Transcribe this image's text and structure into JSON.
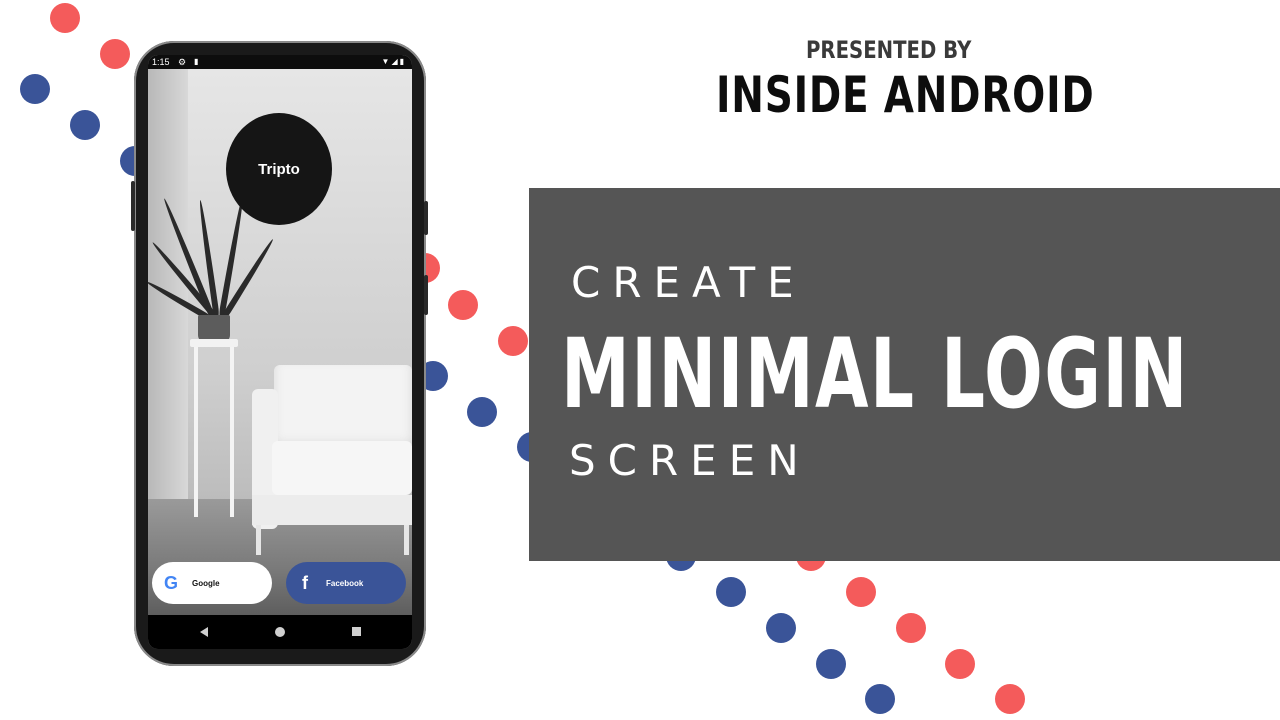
{
  "header": {
    "presented_by": "PRESENTED BY",
    "brand": "INSIDE ANDROID"
  },
  "title": {
    "line1": "CREATE",
    "line2": "MINIMAL LOGIN",
    "line3": "SCREEN"
  },
  "phone": {
    "status_time": "1:15",
    "app_name": "Tripto",
    "buttons": {
      "google_label": "Google",
      "facebook_label": "Facebook"
    }
  },
  "icons": [
    "settings-icon",
    "sd-card-icon",
    "wifi-icon",
    "signal-icon",
    "battery-icon",
    "google-logo-icon",
    "facebook-logo-icon",
    "back-icon",
    "home-icon",
    "recents-icon"
  ],
  "colors": {
    "dot_red": "#f45b5b",
    "dot_blue": "#3a5498",
    "panel": "#555555",
    "facebook": "#3a5498"
  }
}
